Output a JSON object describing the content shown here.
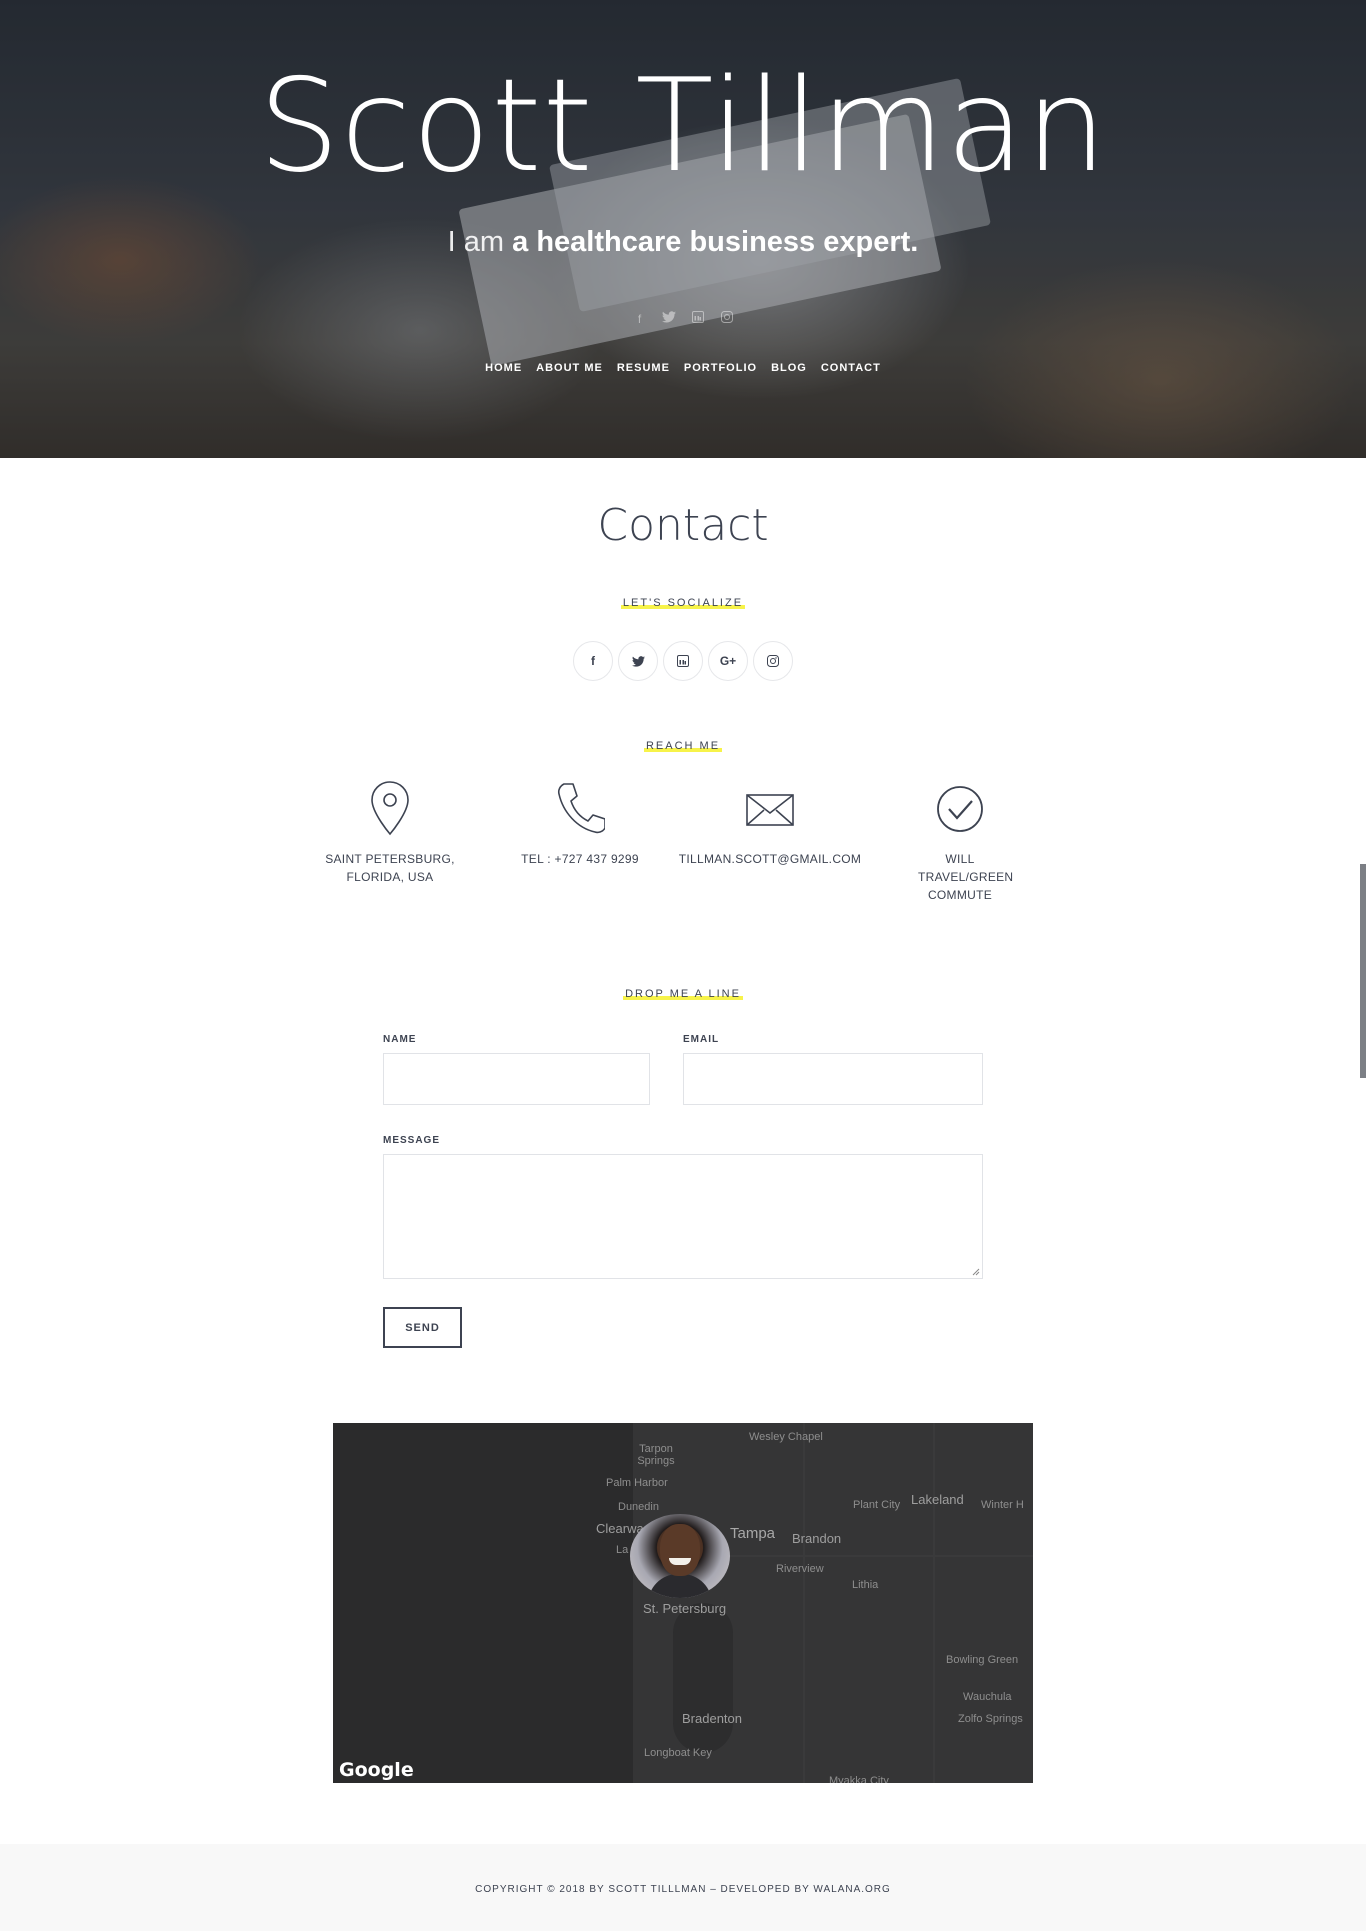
{
  "hero": {
    "name": "Scott Tillman",
    "tagline_prefix": "I am",
    "tagline_emphasis": "a healthcare business expert.",
    "social_icons": [
      "facebook-icon",
      "twitter-icon",
      "linkedin-icon",
      "instagram-icon"
    ],
    "nav": [
      "HOME",
      "ABOUT ME",
      "RESUME",
      "PORTFOLIO",
      "BLOG",
      "CONTACT"
    ]
  },
  "contact": {
    "title": "Contact",
    "socialize_label": "LET'S SOCIALIZE",
    "social_buttons": [
      {
        "icon": "facebook-icon",
        "glyph": "f"
      },
      {
        "icon": "twitter-icon",
        "glyph": "t"
      },
      {
        "icon": "linkedin-icon",
        "glyph": "in"
      },
      {
        "icon": "google-plus-icon",
        "glyph": "G+"
      },
      {
        "icon": "instagram-icon",
        "glyph": "◎"
      }
    ],
    "reach_label": "REACH ME",
    "reach_items": [
      {
        "icon": "map-pin-icon",
        "text": "SAINT PETERSBURG, FLORIDA, USA"
      },
      {
        "icon": "phone-icon",
        "text": "TEL : +727 437 9299"
      },
      {
        "icon": "envelope-icon",
        "text": "TILLMAN.SCOTT@GMAIL.COM"
      },
      {
        "icon": "checkmark-icon",
        "text": "WILL TRAVEL/GREEN COMMUTE"
      }
    ],
    "form_label": "DROP ME A LINE",
    "form": {
      "name_label": "NAME",
      "email_label": "EMAIL",
      "message_label": "MESSAGE",
      "send_label": "SEND"
    }
  },
  "map": {
    "places": {
      "wesley_chapel": "Wesley Chapel",
      "tarpon_springs": "Tarpon\nSprings",
      "palm_harbor": "Palm Harbor",
      "dunedin": "Dunedin",
      "clearwater": "Clearwa",
      "largo": "La",
      "tampa": "Tampa",
      "brandon": "Brandon",
      "plant_city": "Plant City",
      "lakeland": "Lakeland",
      "winter_haven": "Winter H",
      "riverview": "Riverview",
      "lithia": "Lithia",
      "st_petersburg": "St. Petersburg",
      "bowling_green": "Bowling Green",
      "wauchula": "Wauchula",
      "zolfo_springs": "Zolfo Springs",
      "bradenton": "Bradenton",
      "longboat_key": "Longboat Key",
      "myakka_city": "Myakka City"
    },
    "brand": "Google"
  },
  "footer": {
    "copyright": "COPYRIGHT © 2018 BY SCOTT TILLLMAN – DEVELOPED BY WALANA.ORG"
  },
  "colors": {
    "text": "#3d4351",
    "highlight": "#f7f34a",
    "map_bg": "#2d2d2e",
    "footer_bg": "#f8f8f8"
  }
}
